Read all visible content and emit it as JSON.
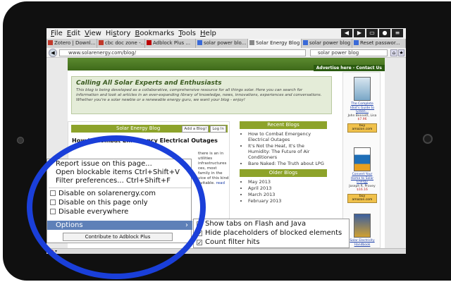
{
  "menubar": {
    "items": [
      {
        "pre": "",
        "key": "F",
        "post": "ile"
      },
      {
        "pre": "",
        "key": "E",
        "post": "dit"
      },
      {
        "pre": "",
        "key": "V",
        "post": "iew"
      },
      {
        "pre": "Hi",
        "key": "s",
        "post": "tory"
      },
      {
        "pre": "",
        "key": "B",
        "post": "ookmarks"
      },
      {
        "pre": "",
        "key": "T",
        "post": "ools"
      },
      {
        "pre": "",
        "key": "H",
        "post": "elp"
      }
    ]
  },
  "tabs": [
    {
      "label": "Zotero | Downl...",
      "color": "#c0392b"
    },
    {
      "label": "cbc doc zone -...",
      "color": "#c0392b"
    },
    {
      "label": "Adblock Plus ...",
      "color": "#b00"
    },
    {
      "label": "solar power blo...",
      "color": "#3a6ad8"
    },
    {
      "label": "Solar Energy Blog",
      "color": "#888"
    },
    {
      "label": "solar power blog",
      "color": "#3a6ad8"
    },
    {
      "label": "Reset passwor...",
      "color": "#3a6ad8"
    }
  ],
  "urlbar": {
    "url": "www.solarenergy.com/blog/",
    "search": "solar power blog"
  },
  "page": {
    "advert": "Advertise here - Contact Us",
    "hero_title": "Calling All Solar Experts and Enthusiasts",
    "hero_text": "This blog is being developed as a collaborative, comprehensive resource for all things solar. Here you can search for information and look at articles in an ever-expanding library of knowledge, news, innovations, experiences and conversations. Whether you're a solar newbie or a renewable energy guru, we want your blog - enjoy!",
    "main_head": "Solar Energy Blog",
    "add_blog": "Add a Blog!",
    "log_in": "Log In",
    "post_title": "How to Combat Emergency Electrical Outages",
    "post_text": "there is an in utilities infrastructures ces, most family in the vice of this kind evitable.",
    "read_more": "read",
    "recent_head": "Recent Blogs",
    "recent": [
      "How to Combat Emergency Electrical Outages",
      "It's Not the Heat, It's the Humidity: The Future of Air Conditioners",
      "Bare Naked: The Truth about LPG"
    ],
    "older_head": "Older Blogs",
    "older": [
      "May 2013",
      "April 2013",
      "March 2013",
      "February 2013"
    ],
    "books": [
      {
        "title": "The Complete Idiot's Guide to Green...",
        "author": "John Bennett, Lisa",
        "price": "$7.96",
        "amazon": "buy amazon.com"
      },
      {
        "title": "Convert Your Home to Solar Energy",
        "author": "Joseph R. Provey",
        "price": "$16.16",
        "amazon": "buy amazon.com"
      },
      {
        "title": "Solar Electricity Handbook",
        "author": "",
        "price": "",
        "amazon": ""
      }
    ]
  },
  "abp_menu": {
    "report": "Report issue on this page...",
    "open_blockable": "Open blockable items",
    "open_blockable_shortcut": "Ctrl+Shift+V",
    "filter_prefs": "Filter preferences...",
    "filter_prefs_shortcut": "Ctrl+Shift+F",
    "disable_site": "Disable on solarenergy.com",
    "disable_page": "Disable on this page only",
    "disable_everywhere": "Disable everywhere",
    "options": "Options",
    "contribute": "Contribute to Adblock Plus"
  },
  "options_submenu": {
    "items": [
      "Show tabs on Flash and Java",
      "Hide placeholders of blocked elements",
      "Count filter hits"
    ]
  },
  "colors": {
    "highlight_circle": "#1a3fd9",
    "menu_selected": "#5e80b8",
    "blog_green": "#8da32a"
  }
}
